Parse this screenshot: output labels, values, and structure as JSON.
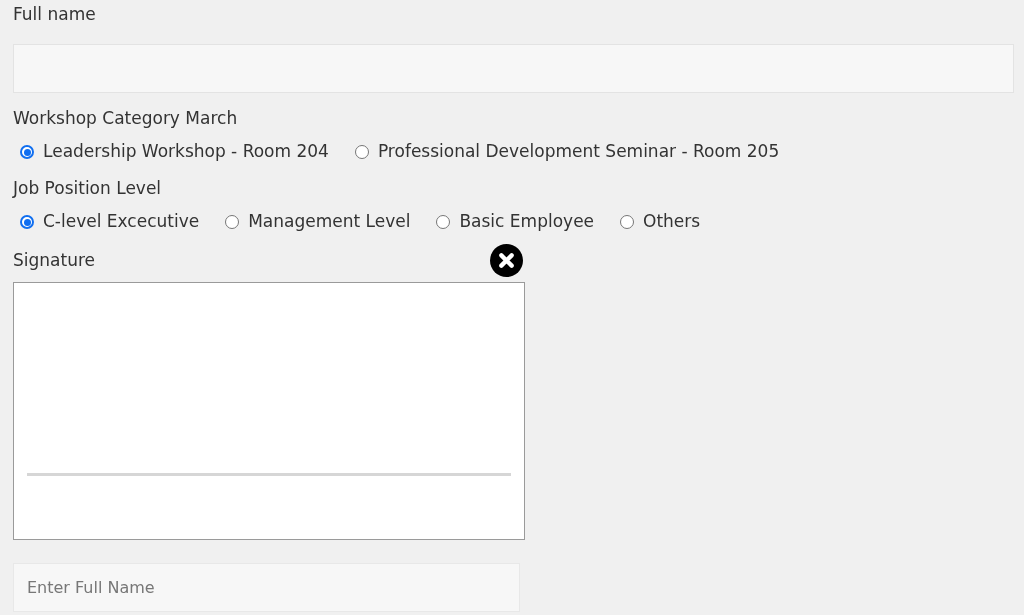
{
  "full_name": {
    "label": "Full name"
  },
  "workshop_category": {
    "label": "Workshop Category March",
    "options": [
      {
        "label": "Leadership Workshop - Room 204",
        "selected": true
      },
      {
        "label": "Professional Development Seminar - Room 205",
        "selected": false
      }
    ]
  },
  "job_position_level": {
    "label": "Job Position Level",
    "options": [
      {
        "label": "C-level Excecutive",
        "selected": true
      },
      {
        "label": "Management Level",
        "selected": false
      },
      {
        "label": "Basic Employee",
        "selected": false
      },
      {
        "label": "Others",
        "selected": false
      }
    ]
  },
  "signature": {
    "label": "Signature"
  },
  "name_field": {
    "placeholder": "Enter Full Name"
  }
}
